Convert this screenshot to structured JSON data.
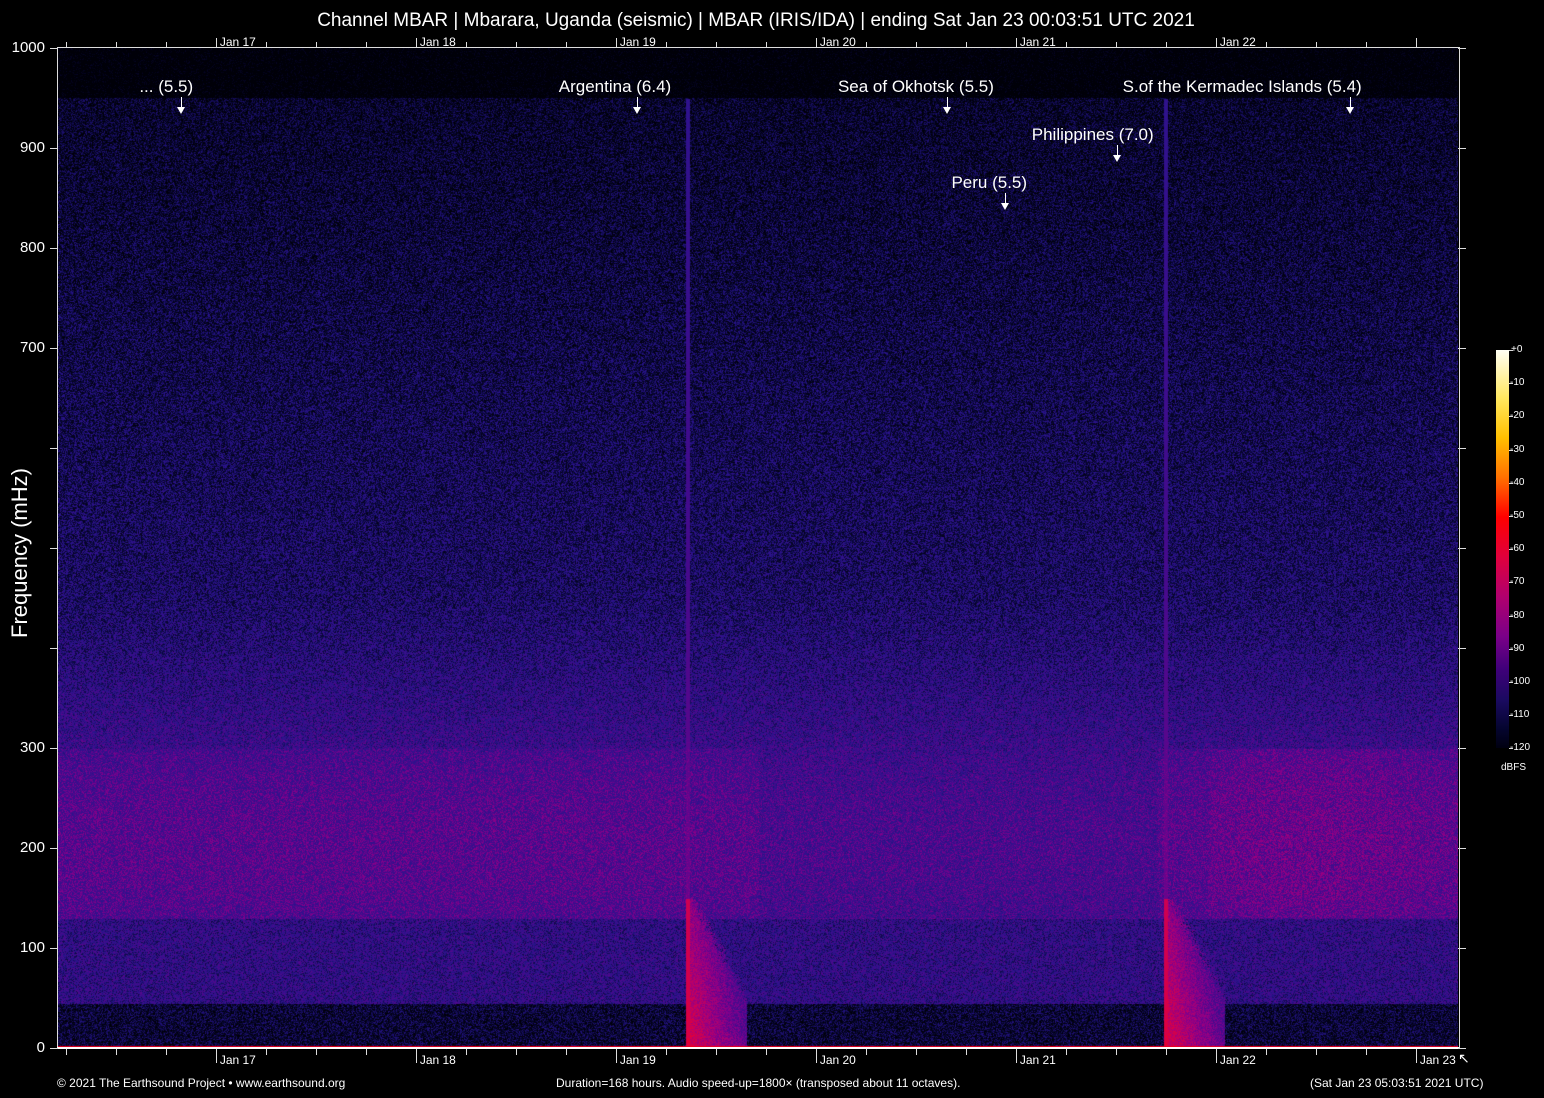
{
  "title": "Channel MBAR | Mbarara, Uganda (seismic) | MBAR (IRIS/IDA) | ending Sat Jan 23 00:03:51 UTC 2021",
  "footer": {
    "copyright": "© 2021 The Earthsound Project • www.earthsound.org",
    "info": "Duration=168 hours. Audio speed-up=1800× (transposed about 11 octaves).",
    "timestamp": "(Sat Jan 23 05:03:51 2021 UTC)"
  },
  "chart_data": {
    "type": "heatmap",
    "title": "Channel MBAR | Mbarara, Uganda (seismic) | MBAR (IRIS/IDA) | ending Sat Jan 23 00:03:51 UTC 2021",
    "xlabel": "",
    "ylabel": "Frequency (mHz)",
    "ylim": [
      0,
      1000
    ],
    "y_tick_labels": [
      "1000",
      "900",
      "800",
      "700",
      "",
      "",
      "",
      "300",
      "200",
      "100",
      "0"
    ],
    "x_range_hours": [
      0,
      168
    ],
    "x_tick_labels": [
      "Jan 17",
      "Jan 18",
      "Jan 19",
      "Jan 20",
      "Jan 21",
      "Jan 22",
      "Jan 23"
    ],
    "x_tick_hours": [
      18.94,
      42.94,
      66.94,
      90.94,
      114.94,
      138.94,
      162.94
    ],
    "colorbar": {
      "label": "dBFS",
      "ticks": [
        "+0",
        "-10",
        "-20",
        "-30",
        "-40",
        "-50",
        "-60",
        "-70",
        "-80",
        "-90",
        "-100",
        "-110",
        "-120"
      ],
      "range": [
        -120,
        0
      ]
    },
    "events": [
      {
        "label": "... (5.5)",
        "hour": 14.8
      },
      {
        "label": "Argentina (6.4)",
        "hour": 69.5
      },
      {
        "label": "Sea of Okhotsk (5.5)",
        "hour": 106.7
      },
      {
        "label": "Peru (5.5)",
        "hour": 113.6
      },
      {
        "label": "Philippines (7.0)",
        "hour": 127.1
      },
      {
        "label": "S.of the Kermadec Islands (5.4)",
        "hour": 155.0
      }
    ],
    "strong_arrivals_hours": [
      75.4,
      132.8
    ]
  }
}
